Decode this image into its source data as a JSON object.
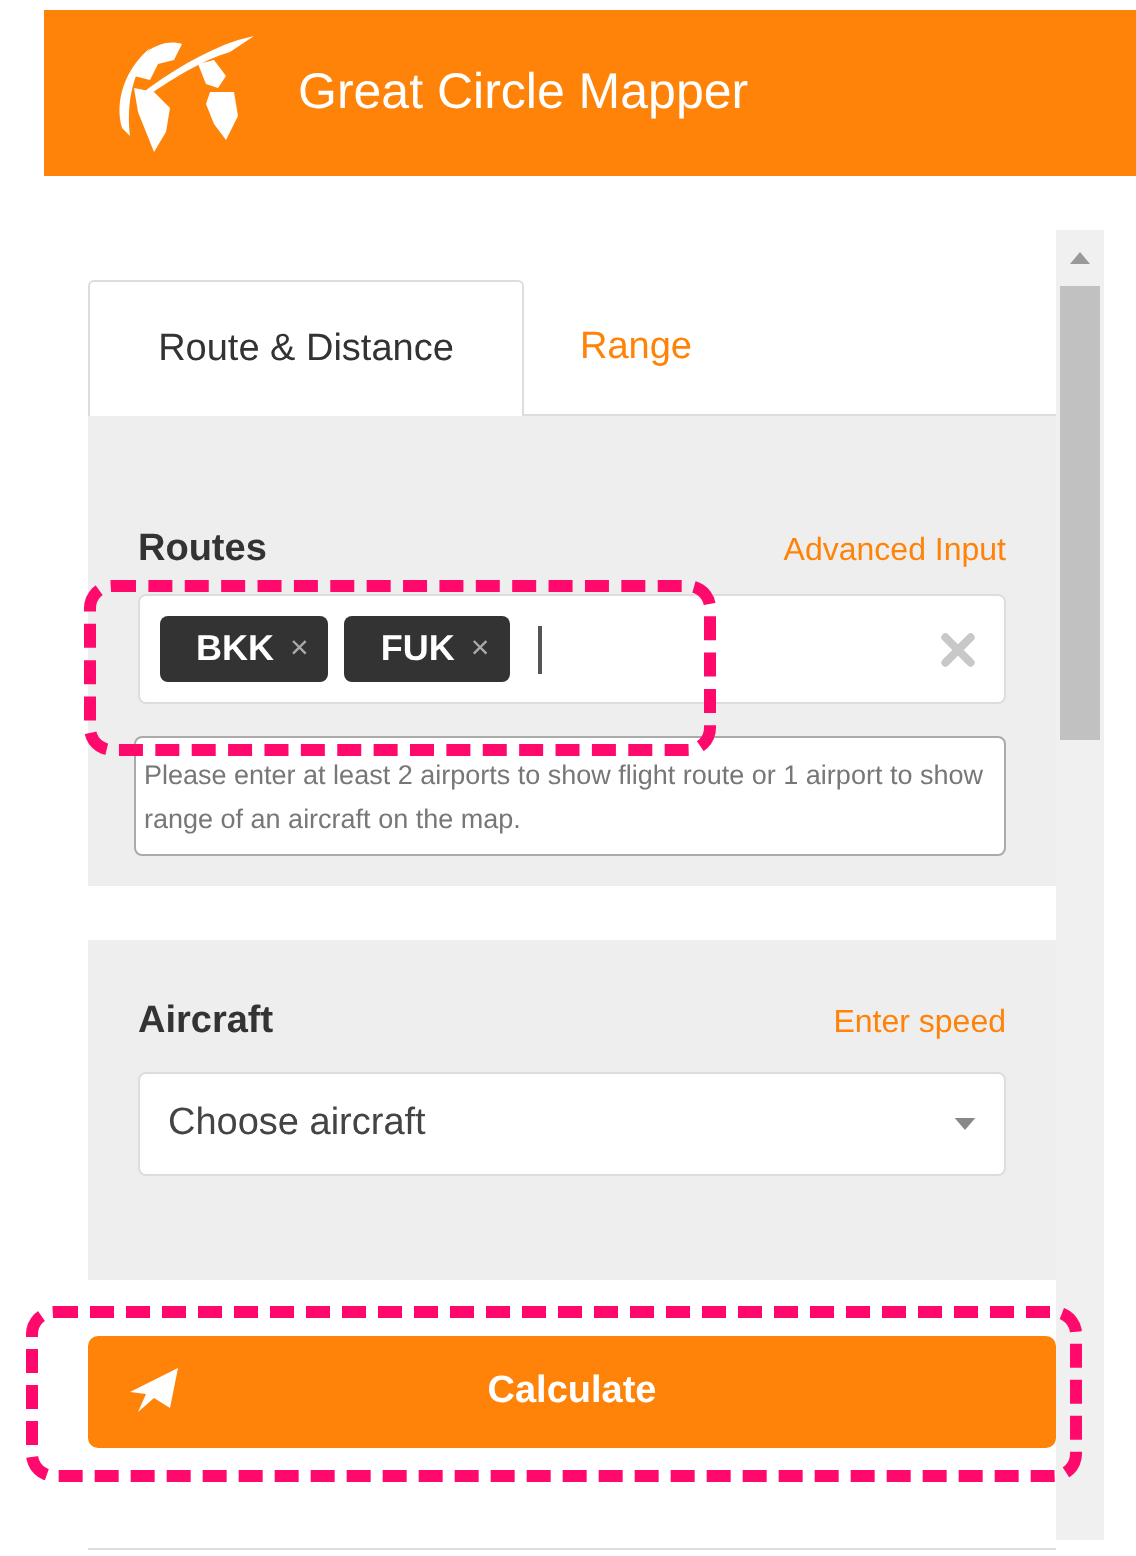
{
  "header": {
    "title": "Great Circle Mapper"
  },
  "tabs": [
    {
      "label": "Route & Distance",
      "selected": true
    },
    {
      "label": "Range",
      "selected": false
    }
  ],
  "routes": {
    "label": "Routes",
    "link": "Advanced Input",
    "tags": [
      {
        "code": "BKK",
        "remove": "×"
      },
      {
        "code": "FUK",
        "remove": "×"
      }
    ],
    "hint": "Please enter at least 2 airports to show flight route or 1 airport to show range of an aircraft on the map."
  },
  "aircraft": {
    "label": "Aircraft",
    "link": "Enter speed",
    "select": {
      "placeholder": "Choose aircraft"
    }
  },
  "calculate_button": {
    "label": "Calculate"
  }
}
